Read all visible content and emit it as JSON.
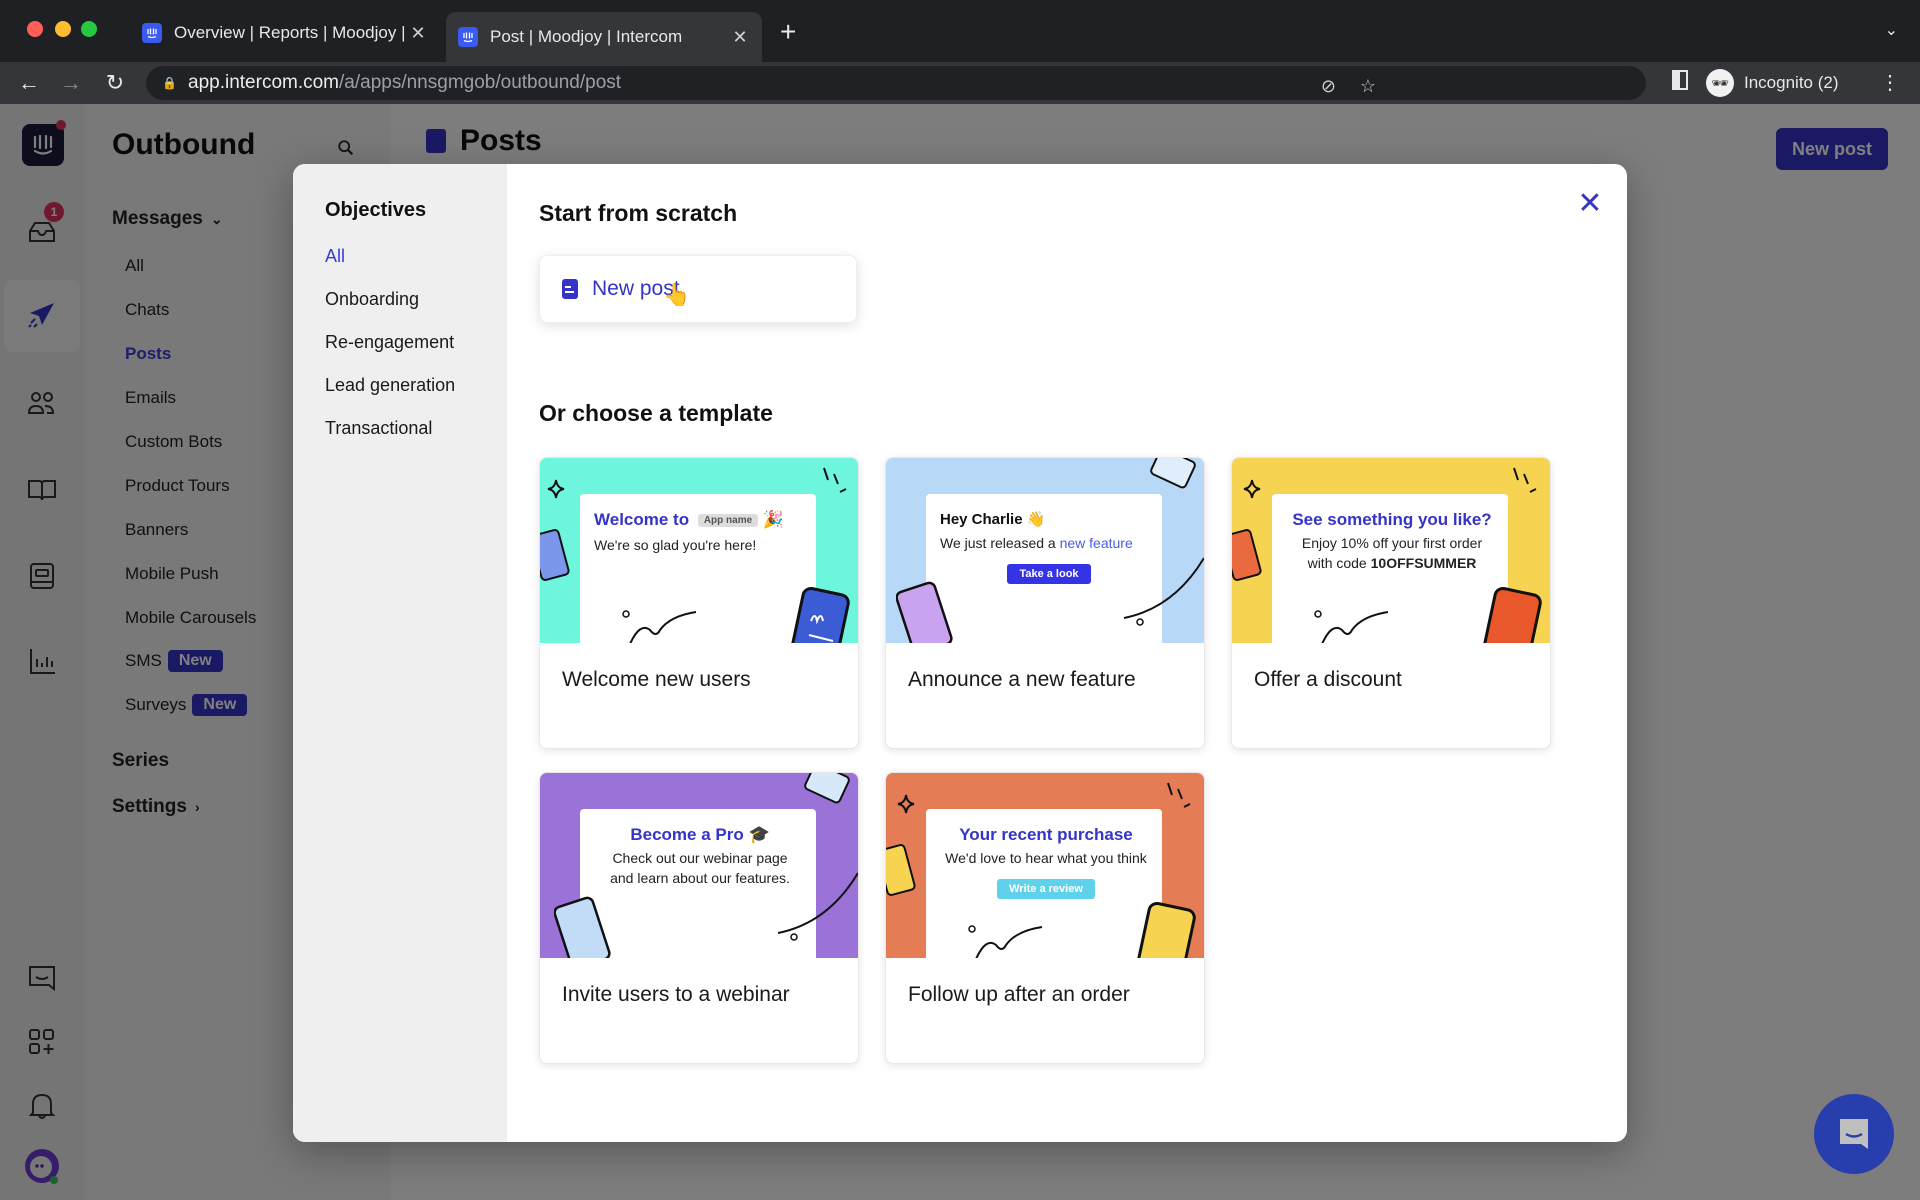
{
  "browser": {
    "tabs": [
      {
        "title": "Overview | Reports | Moodjoy |",
        "active": false
      },
      {
        "title": "Post | Moodjoy | Intercom",
        "active": true
      }
    ],
    "url_host": "app.intercom.com",
    "url_path": "/a/apps/nnsgmgob/outbound/post",
    "profile_label": "Incognito (2)"
  },
  "rail": {
    "inbox_badge": "1",
    "items": [
      "intercom-logo",
      "inbox-icon",
      "outbound-icon",
      "contacts-icon",
      "articles-icon",
      "inbox-apps-icon",
      "reports-icon",
      "messenger-icon",
      "app-store-icon",
      "notifications-icon",
      "avatar"
    ]
  },
  "subnav": {
    "title": "Outbound",
    "messages_label": "Messages",
    "items": [
      {
        "label": "All"
      },
      {
        "label": "Chats"
      },
      {
        "label": "Posts",
        "active": true
      },
      {
        "label": "Emails"
      },
      {
        "label": "Custom Bots"
      },
      {
        "label": "Product Tours"
      },
      {
        "label": "Banners"
      },
      {
        "label": "Mobile Push"
      },
      {
        "label": "Mobile Carousels"
      },
      {
        "label": "SMS",
        "badge": "New"
      },
      {
        "label": "Surveys",
        "badge": "New"
      }
    ],
    "series_label": "Series",
    "settings_label": "Settings"
  },
  "main": {
    "title": "Posts",
    "new_post_button": "New post"
  },
  "modal": {
    "objectives_title": "Objectives",
    "objectives": [
      {
        "label": "All",
        "active": true
      },
      {
        "label": "Onboarding"
      },
      {
        "label": "Re-engagement"
      },
      {
        "label": "Lead generation"
      },
      {
        "label": "Transactional"
      }
    ],
    "scratch_title": "Start from scratch",
    "scratch_card_label": "New post",
    "template_title": "Or choose a template",
    "templates": [
      {
        "label": "Welcome new users",
        "bg": "#6ef5de",
        "heading": "Welcome to",
        "pill": "App name",
        "emoji": "🎉",
        "text": "We're so glad you're here!"
      },
      {
        "label": "Announce a new feature",
        "bg": "#b8d8f8",
        "heading": "Hey Charlie",
        "emoji": "👋",
        "text_prefix": "We just released a ",
        "text_link": "new feature",
        "button": "Take a look"
      },
      {
        "label": "Offer a discount",
        "bg": "#f6d452",
        "heading": "See something you like?",
        "text_line1": "Enjoy 10% off your first order",
        "text_line2_prefix": "with code ",
        "code": "10OFFSUMMER"
      },
      {
        "label": "Invite users to a webinar",
        "bg": "#9b72d8",
        "heading": "Become a Pro",
        "emoji": "🎓",
        "text_line1": "Check out our webinar page",
        "text_line2": "and learn about our features."
      },
      {
        "label": "Follow up after an order",
        "bg": "#e47c56",
        "heading": "Your recent purchase",
        "text": "We'd love to hear what you think",
        "button": "Write a review"
      }
    ]
  },
  "colors": {
    "accent": "#3434c8",
    "badge_red": "#e0335d"
  }
}
